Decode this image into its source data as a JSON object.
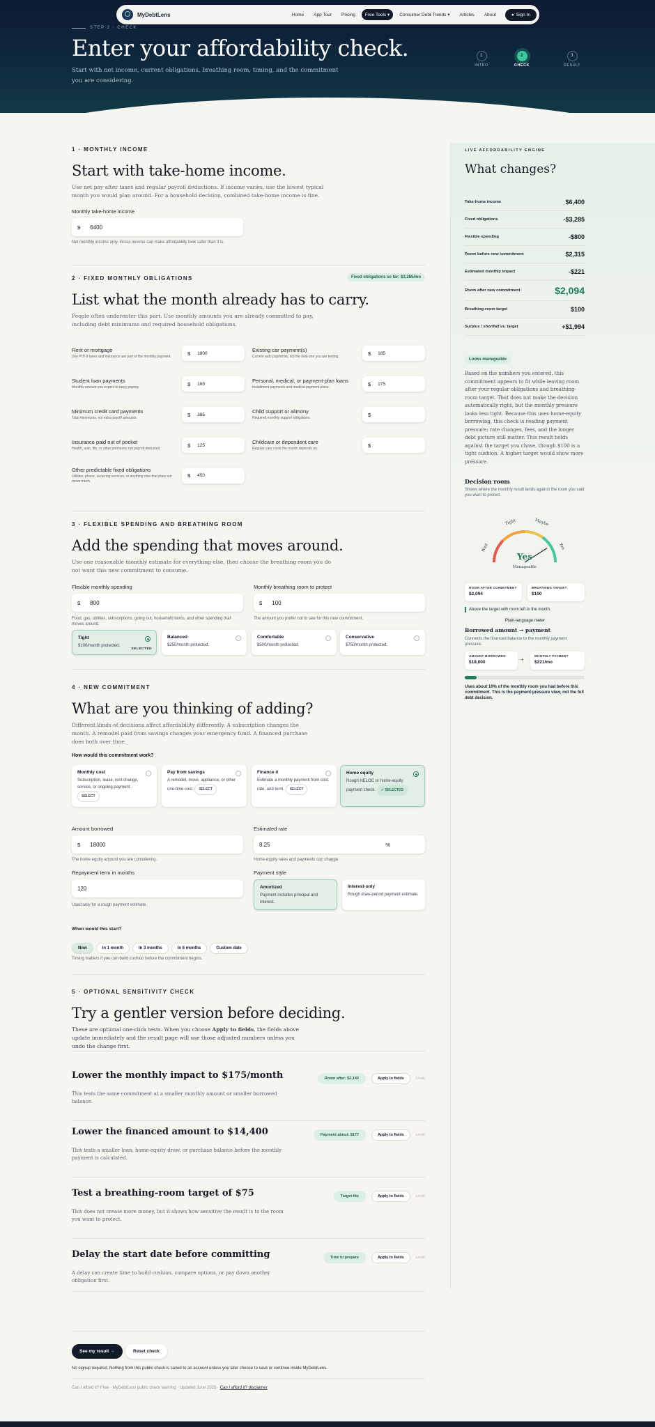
{
  "nav": {
    "brand": "MyDebtLens",
    "items": [
      "Home",
      "App Tour",
      "Pricing",
      "Free Tools",
      "Consumer Debt Trends",
      "Articles",
      "About"
    ],
    "signin": "Sign In"
  },
  "hero": {
    "step_label": "Step 2 · Check",
    "title": "Enter your affordability check.",
    "subtitle": "Start with net income, current obligations, breathing room, timing, and the commitment you are considering.",
    "steps": [
      {
        "num": "1",
        "label": "INTRO"
      },
      {
        "num": "2",
        "label": "CHECK"
      },
      {
        "num": "3",
        "label": "RESULT"
      }
    ]
  },
  "income": {
    "eyebrow": "1 · Monthly income",
    "title": "Start with take-home income.",
    "lead": "Use net pay after taxes and regular payroll deductions. If income varies, use the lowest typical month you would plan around. For a household decision, combined take-home income is fine.",
    "field_label": "Monthly take-home income",
    "currency": "$",
    "value": "6400",
    "hint": "Net monthly income only. Gross income can make affordability look safer than it is."
  },
  "obligations": {
    "eyebrow": "2 · Fixed monthly obligations",
    "badge": "Fixed obligations so far: $3,285/mo",
    "title": "List what the month already has to carry.",
    "lead": "People often underenter this part. Use monthly amounts you are already committed to pay, including debt minimums and required household obligations.",
    "currency": "$",
    "rows": [
      {
        "title": "Rent or mortgage",
        "sub": "Use PITI if taxes and insurance are part of the monthly payment.",
        "value": "1800"
      },
      {
        "title": "Existing car payment(s)",
        "sub": "Current auto payments, not the new one you are testing.",
        "value": "185"
      },
      {
        "title": "Student loan payments",
        "sub": "Monthly amount you expect to keep paying.",
        "value": "165"
      },
      {
        "title": "Personal, medical, or payment-plan loans",
        "sub": "Installment payments and medical payment plans.",
        "value": "175"
      },
      {
        "title": "Minimum credit card payments",
        "sub": "Total minimums, not extra payoff amounts.",
        "value": "385"
      },
      {
        "title": "Child support or alimony",
        "sub": "Required monthly support obligations.",
        "value": ""
      },
      {
        "title": "Insurance paid out of pocket",
        "sub": "Health, auto, life, or other premiums not payroll-deducted.",
        "value": "125"
      },
      {
        "title": "Childcare or dependent care",
        "sub": "Regular care costs the month depends on.",
        "value": ""
      },
      {
        "title": "Other predictable fixed obligations",
        "sub": "Utilities, phone, recurring services, or anything else that does not move much.",
        "value": "450"
      }
    ]
  },
  "flexible": {
    "eyebrow": "3 · Flexible spending and breathing room",
    "title": "Add the spending that moves around.",
    "lead": "Use one reasonable monthly estimate for everything else, then choose the breathing room you do not want this new commitment to consume.",
    "spend_label": "Flexible monthly spending",
    "spend_value": "800",
    "spend_hint": "Food, gas, utilities, subscriptions, going out, household items, and other spending that moves around.",
    "room_label": "Monthly breathing room to protect",
    "room_value": "100",
    "room_hint": "The amount you prefer not to see for this new commitment.",
    "currency": "$",
    "options": [
      {
        "title": "Tight",
        "desc": "$100/month protected.",
        "tag": "SELECTED"
      },
      {
        "title": "Balanced",
        "desc": "$250/month protected.",
        "tag": ""
      },
      {
        "title": "Comfortable",
        "desc": "$500/month protected.",
        "tag": ""
      },
      {
        "title": "Conservative",
        "desc": "$750/month protected.",
        "tag": ""
      }
    ]
  },
  "commitment": {
    "eyebrow": "4 · New commitment",
    "title": "What are you thinking of adding?",
    "lead": "Different kinds of decisions affect affordability differently. A subscription changes the month. A remodel paid from savings changes your emergency fund. A financed purchase does both over time.",
    "question": "How would this commitment work?",
    "types": [
      {
        "title": "Monthly cost",
        "desc": "Subscription, lease, rent change, service, or ongoing payment.",
        "tag": "SELECT"
      },
      {
        "title": "Pay from savings",
        "desc": "A remodel, move, appliance, or other one-time cost.",
        "tag": "SELECT"
      },
      {
        "title": "Finance it",
        "desc": "Estimate a monthly payment from cost, rate, and term.",
        "tag": "SELECT"
      },
      {
        "title": "Home equity",
        "desc": "Rough HELOC or home-equity payment check.",
        "tag": "✓ SELECTED"
      }
    ],
    "amount_label": "Amount borrowed",
    "amount_value": "18000",
    "amount_hint": "The home equity amount you are considering.",
    "rate_label": "Estimated rate",
    "rate_value": "8.25",
    "rate_unit": "%",
    "rate_hint": "Home-equity rates and payments can change.",
    "term_label": "Repayment term in months",
    "term_value": "120",
    "term_hint": "Used only for a rough payment estimate.",
    "style_label": "Payment style",
    "styles": [
      {
        "title": "Amortized",
        "desc": "Payment includes principal and interest."
      },
      {
        "title": "Interest-only",
        "desc": "Rough draw-period payment estimate."
      }
    ],
    "start_label": "When would this start?",
    "start_options": [
      "Now",
      "In 1 month",
      "In 3 months",
      "In 6 months",
      "Custom date"
    ],
    "start_hint": "Timing matters if you can build cushion before the commitment begins.",
    "currency": "$"
  },
  "sensitivity": {
    "eyebrow": "5 · Optional sensitivity check",
    "title": "Try a gentler version before deciding.",
    "lead_part1": "These are optional one-click tests. When you choose ",
    "lead_bold": "Apply to fields",
    "lead_part2": ", the fields above update immediately and the result page will use those adjusted numbers unless you undo the change first.",
    "apply_label": "Apply to fields",
    "undo_label": "Undo",
    "rows": [
      {
        "title": "Lower the monthly impact to $175/month",
        "desc": "This tests the same commitment at a smaller monthly amount or smaller borrowed balance.",
        "badge": "Room after: $2,140"
      },
      {
        "title": "Lower the financed amount to $14,400",
        "desc": "This tests a smaller loan, home-equity draw, or purchase balance before the monthly payment is calculated.",
        "badge": "Payment about: $177"
      },
      {
        "title": "Test a breathing-room target of $75",
        "desc": "This does not create more money, but it shows how sensitive the result is to the room you want to protect.",
        "badge": "Target fits"
      },
      {
        "title": "Delay the start date before committing",
        "desc": "A delay can create time to build cushion, compare options, or pay down another obligation first.",
        "badge": "Time to prepare"
      }
    ]
  },
  "actions": {
    "primary": "See my result →",
    "secondary": "Reset check",
    "note": "No signup required. Nothing from this public check is saved to an account unless you later choose to save or continue inside MyDebtLens.",
    "footer_text": "Can I afford it? Free · MyDebtLens public check warning · Updated June 2025 ·",
    "footer_link": "Can I afford it? disclaimer"
  },
  "engine": {
    "eyebrow": "Live affordability engine",
    "title": "What changes?",
    "rows": [
      {
        "k": "Take-home income",
        "v": "$6,400"
      },
      {
        "k": "Fixed obligations",
        "v": "-$3,285"
      },
      {
        "k": "Flexible spending",
        "v": "-$800"
      },
      {
        "k": "Room before new commitment",
        "v": "$2,315"
      },
      {
        "k": "Estimated monthly impact",
        "v": "-$221"
      },
      {
        "k": "Room after new commitment",
        "v": "$2,094"
      },
      {
        "k": "Breathing-room target",
        "v": "$100"
      },
      {
        "k": "Surplus / shortfall vs. target",
        "v": "+$1,994"
      }
    ],
    "status": "Looks manageable",
    "explain": "Based on the numbers you entered, this commitment appears to fit while leaving room after your regular obligations and breathing-room target. That does not make the decision automatically right, but the monthly pressure looks less tight. Because this uses home-equity borrowing, this check is reading payment pressure; rate changes, fees, and the longer debt picture still matter. This result holds against the target you chose, though $100 is a tight cushion. A higher target would show more pressure.",
    "decision_title": "Decision room",
    "decision_sub": "Shows where the monthly result lands against the room you said you want to protect.",
    "gauge": {
      "labels": [
        "Wait",
        "Tight",
        "Maybe",
        "Yes"
      ],
      "value": "Yes",
      "caption": "Manageable",
      "level": 0.82
    },
    "mini": [
      {
        "label": "ROOM AFTER COMMITMENT",
        "value": "$2,094"
      },
      {
        "label": "BREATHING TARGET",
        "value": "$100"
      }
    ],
    "above_note": "Above the target with room left in the month.",
    "plain_btn": "Plain-language meter",
    "borrow_title": "Borrowed amount → payment",
    "borrow_sub": "Connects the financed balance to the monthly payment pressure.",
    "borrow_mini": [
      {
        "label": "AMOUNT BORROWED",
        "value": "$18,000"
      },
      {
        "label": "MONTHLY PAYMENT",
        "value": "$221/mo"
      }
    ],
    "borrow_pct": 0.1,
    "borrow_note": "Uses about 10% of the monthly room you had before this commitment. This is the payment-pressure view, not the full debt decision.",
    "colors": {
      "accent": "#1f7a55",
      "good": "#3ec79a",
      "warn": "#e9c046",
      "bad": "#e2574c"
    }
  }
}
